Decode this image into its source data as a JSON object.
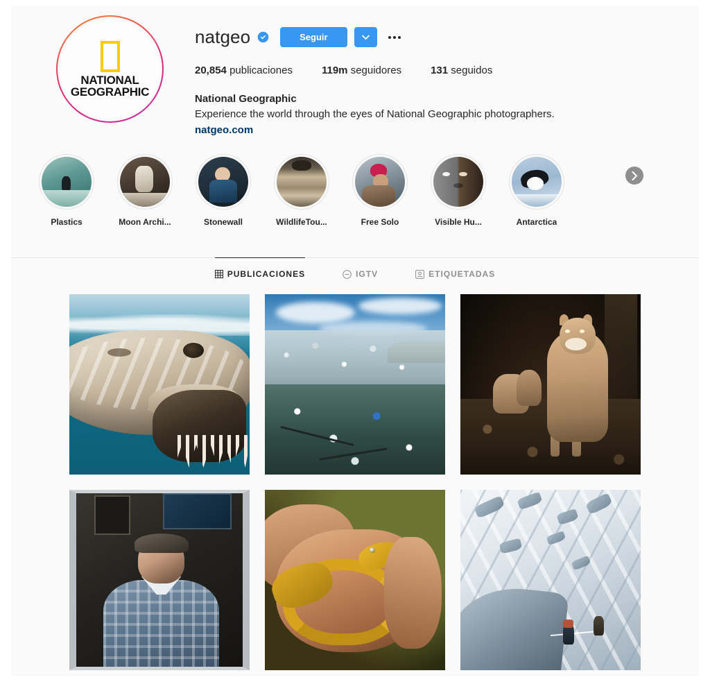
{
  "profile": {
    "username": "natgeo",
    "verified_badge": "verified-icon",
    "follow_label": "Seguir",
    "dropdown_icon": "chevron-down-icon",
    "more_icon": "ellipsis-icon",
    "avatar": {
      "logo_line1": "NATIONAL",
      "logo_line2": "GEOGRAPHIC",
      "ring_colors": [
        "#f58529",
        "#dd2a7b",
        "#c32aa3"
      ],
      "logo_rect_color": "#ffcc00"
    },
    "stats": [
      {
        "value": "20,854",
        "label": "publicaciones"
      },
      {
        "value": "119m",
        "label": "seguidores"
      },
      {
        "value": "131",
        "label": "seguidos"
      }
    ],
    "full_name": "National Geographic",
    "description": "Experience the world through the eyes of National Geographic photographers.",
    "website": "natgeo.com",
    "link_color": "#00376b",
    "accent_color": "#3897f0"
  },
  "highlights": {
    "next_icon": "chevron-right-icon",
    "items": [
      {
        "label": "Plastics",
        "image": "surfer-in-wave"
      },
      {
        "label": "Moon Archi...",
        "image": "astronaut-on-moon"
      },
      {
        "label": "Stonewall",
        "image": "people-group-portrait"
      },
      {
        "label": "WildlifeTou...",
        "image": "animal-in-enclosure"
      },
      {
        "label": "Free Solo",
        "image": "climber-red-cap"
      },
      {
        "label": "Visible Hu...",
        "image": "split-face-portrait"
      },
      {
        "label": "Antarctica",
        "image": "penguin-on-ice"
      }
    ]
  },
  "tabs": [
    {
      "label": "PUBLICACIONES",
      "icon": "grid-icon",
      "active": true
    },
    {
      "label": "IGTV",
      "icon": "igtv-icon",
      "active": false
    },
    {
      "label": "ETIQUETADAS",
      "icon": "tagged-icon",
      "active": false
    }
  ],
  "grid": {
    "posts": [
      {
        "alt": "great-white-shark-at-surface"
      },
      {
        "alt": "ocean-plastic-pollution"
      },
      {
        "alt": "mountain-lion-with-cubs-at-night"
      },
      {
        "alt": "portrait-of-older-man-in-plaid-shirt"
      },
      {
        "alt": "hands-holding-yellow-snake"
      },
      {
        "alt": "climbers-on-snowy-glacier"
      }
    ]
  }
}
